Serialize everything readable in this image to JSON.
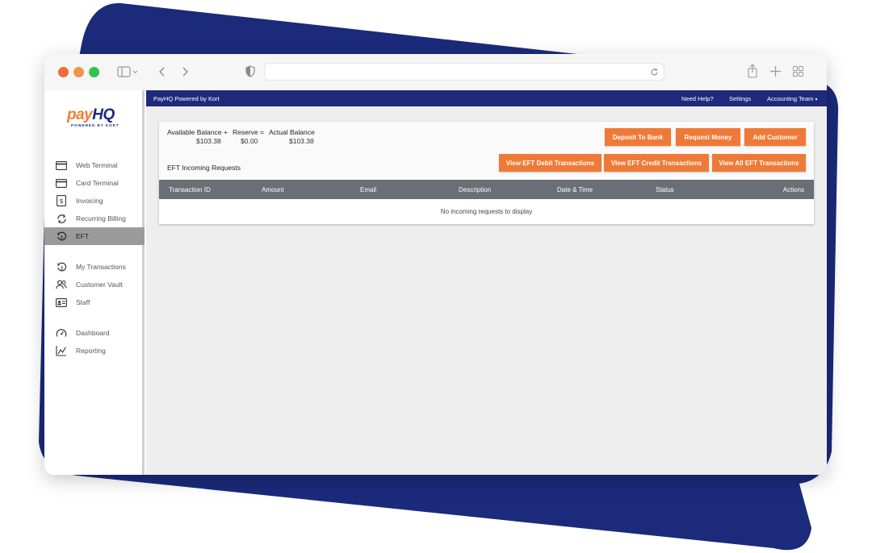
{
  "browser": {
    "traffic_lights": [
      "#f26b3a",
      "#f0954a",
      "#34c24b"
    ]
  },
  "logo": {
    "pay": "pay",
    "hq": "HQ",
    "sub": "POWERED BY KORT"
  },
  "sidebar": {
    "items": [
      {
        "label": "Web Terminal",
        "icon": "card-icon"
      },
      {
        "label": "Card Terminal",
        "icon": "card-terminal-icon"
      },
      {
        "label": "Invoicing",
        "icon": "invoice-icon"
      },
      {
        "label": "Recurring Billing",
        "icon": "refresh-icon"
      },
      {
        "label": "EFT",
        "icon": "eft-icon",
        "active": true
      },
      {
        "label": "My Transactions",
        "icon": "history-icon"
      },
      {
        "label": "Customer Vault",
        "icon": "users-icon"
      },
      {
        "label": "Staff",
        "icon": "id-card-icon"
      },
      {
        "label": "Dashboard",
        "icon": "gauge-icon"
      },
      {
        "label": "Reporting",
        "icon": "chart-icon"
      }
    ]
  },
  "topbar": {
    "brand": "PayHQ Powered by Kort",
    "help": "Need Help?",
    "settings": "Settings",
    "account": "Accounting Team",
    "caret": "▾"
  },
  "balance": {
    "available_label": "Available Balance",
    "plus": "+",
    "reserve_label": "Reserve",
    "equals": "=",
    "actual_label": "Actual Balance",
    "available_value": "$103.38",
    "reserve_value": "$0.00",
    "actual_value": "$103.38"
  },
  "buttons": {
    "deposit": "Deposit To Bank",
    "request": "Request Money",
    "add_customer": "Add Customer",
    "debit": "View EFT Debit Transactions",
    "credit": "View EFT Credit Transactions",
    "all": "View All EFT Transactions"
  },
  "section_title": "EFT Incoming Requests",
  "table": {
    "columns": [
      "Transaction ID",
      "Amount",
      "Email",
      "Description",
      "Date & Time",
      "Status",
      "Actions"
    ],
    "empty_message": "No incoming requests to display"
  },
  "colors": {
    "brand_navy": "#1f2a7a",
    "accent_orange": "#ef7a37",
    "table_header": "#6a6e76"
  }
}
